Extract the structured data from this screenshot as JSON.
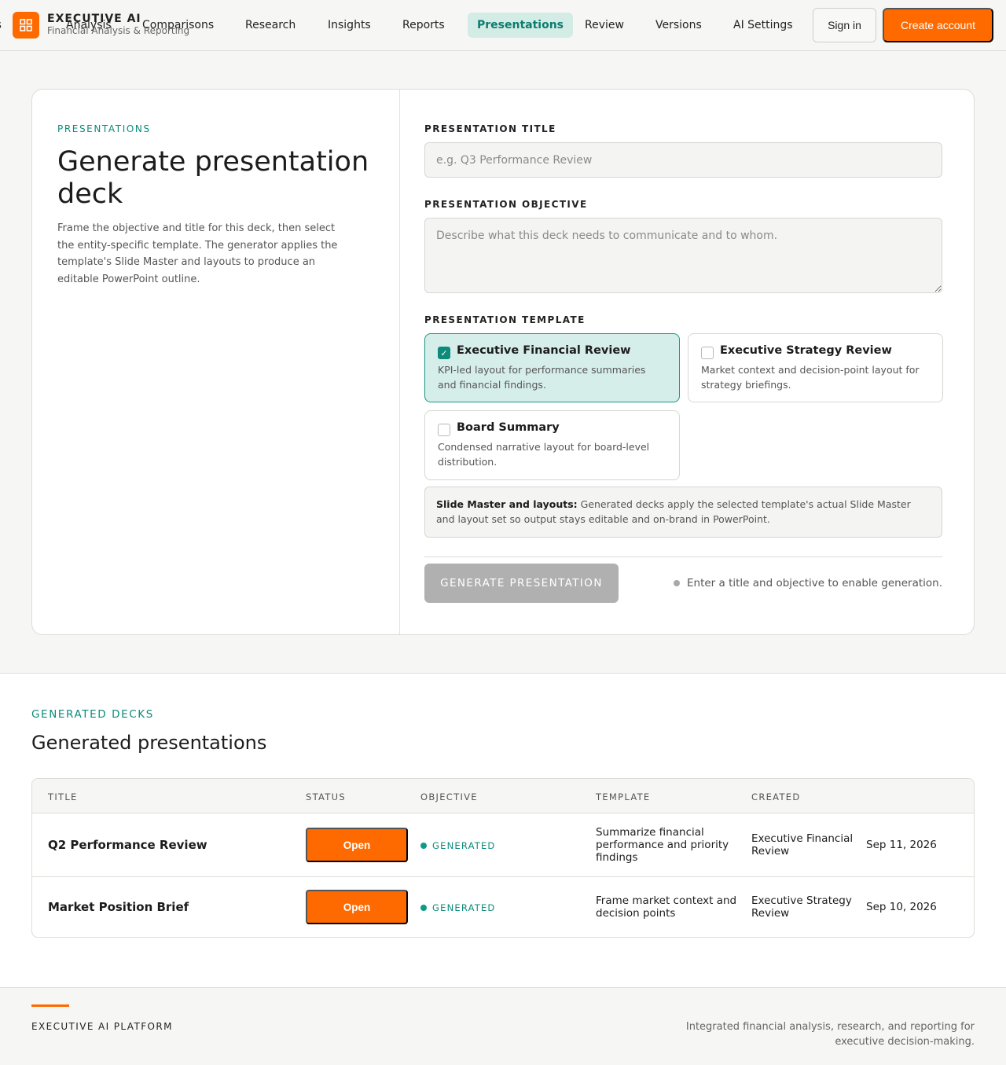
{
  "brand": {
    "name": "EXECUTIVE AI",
    "subtitle": "Financial Analysis & Reporting"
  },
  "nav": {
    "cut_label": "es",
    "items": [
      {
        "label": "Analysis"
      },
      {
        "label": "Comparisons"
      },
      {
        "label": "Research"
      },
      {
        "label": "Insights"
      },
      {
        "label": "Reports"
      },
      {
        "label": "Presentations",
        "active": true
      },
      {
        "label": "Review"
      },
      {
        "label": "Versions"
      },
      {
        "label": "AI Settings"
      }
    ],
    "sign_in": "Sign in",
    "create_account": "Create account"
  },
  "generator": {
    "eyebrow": "PRESENTATIONS",
    "title": "Generate presentation deck",
    "description": "Frame the objective and title for this deck, then select the entity-specific template. The generator applies the template's Slide Master and layouts to produce an editable PowerPoint outline.",
    "title_field": {
      "label": "PRESENTATION TITLE",
      "value": "",
      "placeholder": "e.g. Q3 Performance Review"
    },
    "objective_field": {
      "label": "PRESENTATION OBJECTIVE",
      "value": "",
      "placeholder": "Describe what this deck needs to communicate and to whom."
    },
    "template_label": "PRESENTATION TEMPLATE",
    "templates": [
      {
        "name": "Executive Financial Review",
        "description": "KPI-led layout for performance summaries and financial findings.",
        "selected": true
      },
      {
        "name": "Executive Strategy Review",
        "description": "Market context and decision-point layout for strategy briefings.",
        "selected": false
      },
      {
        "name": "Board Summary",
        "description": "Condensed narrative layout for board-level distribution.",
        "selected": false
      }
    ],
    "master_note": {
      "heading": "Slide Master and layouts:",
      "text": " Generated decks apply the selected template's actual Slide Master and layout set so output stays editable and on-brand in PowerPoint."
    },
    "generate_label": "GENERATE PRESENTATION",
    "generate_hint": "Enter a title and objective to enable generation."
  },
  "generated": {
    "eyebrow": "GENERATED DECKS",
    "title": "Generated presentations",
    "columns": [
      "TITLE",
      "STATUS",
      "OBJECTIVE",
      "TEMPLATE",
      "CREATED"
    ],
    "rows": [
      {
        "title": "Q2 Performance Review",
        "action": "Open",
        "status": "GENERATED",
        "objective": "Summarize financial performance and priority findings",
        "template": "Executive Financial Review",
        "created": "Sep 11, 2026"
      },
      {
        "title": "Market Position Brief",
        "action": "Open",
        "status": "GENERATED",
        "objective": "Frame market context and decision points",
        "template": "Executive Strategy Review",
        "created": "Sep 10, 2026"
      }
    ]
  },
  "footer": {
    "brand": "EXECUTIVE AI PLATFORM",
    "tagline": "Integrated financial analysis, research, and reporting for executive decision-making."
  },
  "colors": {
    "accent": "#ff6a00",
    "teal": "#0b8b7b",
    "active_nav_bg": "#d4ece6",
    "disabled_button": "#b0b0b0"
  },
  "icons": {
    "brand": "grid-icon",
    "checkbox_checked": "check-icon",
    "status": "status-dot-icon",
    "hint": "info-dot-icon"
  }
}
